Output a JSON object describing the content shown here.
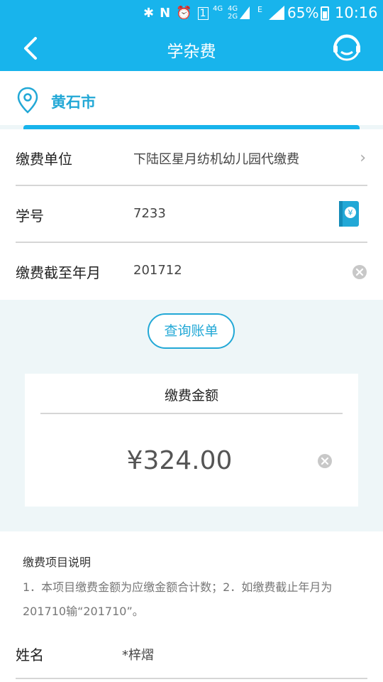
{
  "status_bar": {
    "battery": "65%",
    "time": "10:16",
    "network_a": "4G",
    "network_b": "4G",
    "network_c": "2G",
    "edge": "E"
  },
  "nav": {
    "title": "学杂费"
  },
  "city": {
    "name": "黄石市"
  },
  "form": {
    "unit_label": "缴费单位",
    "unit_value": "下陆区星月纺机幼儿园代缴费",
    "id_label": "学号",
    "id_value": "7233",
    "deadline_label": "缴费截至年月",
    "deadline_value": "201712"
  },
  "query_button": "查询账单",
  "amount_card": {
    "title": "缴费金额",
    "amount": "¥324.00"
  },
  "notes": {
    "title": "缴费项目说明",
    "text": "1．本项目缴费金额为应缴金额合计数；2．如缴费截止年月为201710输“201710”。"
  },
  "name_row": {
    "label": "姓名",
    "value": "*梓熠"
  },
  "colors": {
    "primary": "#18b4ec",
    "accent_text": "#22a8d6"
  }
}
